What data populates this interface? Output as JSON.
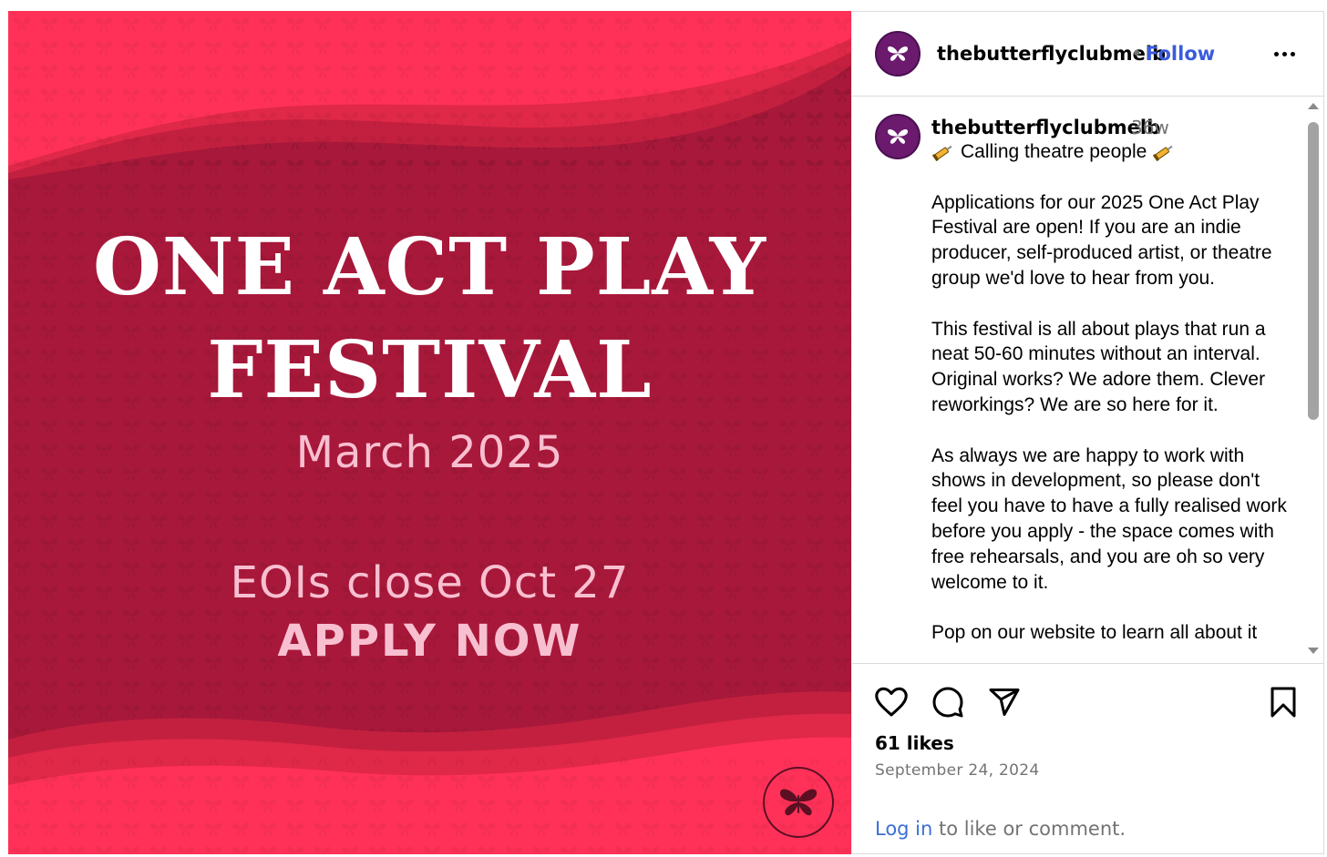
{
  "image": {
    "title_line1": "ONE ACT PLAY",
    "title_line2": "FESTIVAL",
    "date": "March 2025",
    "deadline": "EOIs close Oct 27",
    "cta": "APPLY NOW",
    "colors": {
      "primary": "#ff3158",
      "secondary": "#a8183a",
      "text": "#ffffff",
      "subtext": "#f8bfd0"
    },
    "badge_icon": "butterfly-icon"
  },
  "header": {
    "username": "thebutterflyclubmelb",
    "separator": "•",
    "follow_label": "Follow",
    "more_icon": "more-icon"
  },
  "caption": {
    "username": "thebutterflyclubmelb",
    "time": "36w",
    "headline": "Calling theatre people",
    "paragraphs": [
      "Applications for our 2025 One Act Play Festival are open! If you are an indie producer, self-produced artist, or theatre group we'd love to hear from you.",
      "This festival is all about plays that run a neat 50-60 minutes without an interval. Original works? We adore them. Clever reworkings? We are so here for it.",
      "As always we are happy to work with shows in development, so please don't feel you have to have a fully realised work before you apply - the space comes with free rehearsals, and you are oh so very welcome to it.",
      "Pop on our website to learn all about it"
    ]
  },
  "actions": {
    "icons": [
      "heart-icon",
      "comment-icon",
      "share-icon",
      "bookmark-icon"
    ],
    "likes": "61 likes",
    "date": "September 24, 2024",
    "login_link": "Log in",
    "login_rest": " to like or comment."
  },
  "accent_colors": {
    "follow": "#3b5bdb",
    "link": "#3b6fd6",
    "muted": "#737373",
    "avatar": "#6b1a6e"
  }
}
